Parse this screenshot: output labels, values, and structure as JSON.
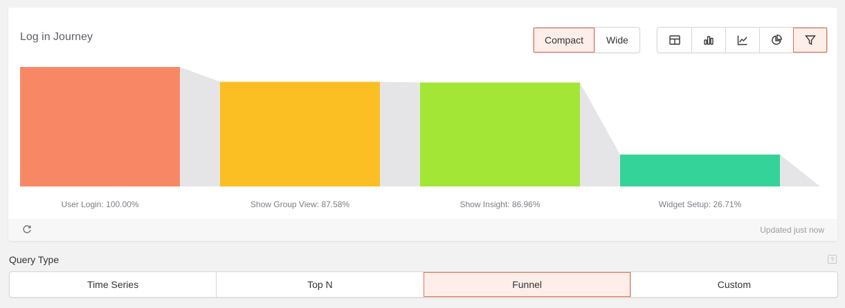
{
  "card": {
    "title": "Log in Journey",
    "layout_options": [
      {
        "label": "Compact",
        "active": true
      },
      {
        "label": "Wide",
        "active": false
      }
    ],
    "viz_icons": [
      {
        "icon": "table-icon",
        "active": false
      },
      {
        "icon": "bar-chart-icon",
        "active": false
      },
      {
        "icon": "line-chart-icon",
        "active": false
      },
      {
        "icon": "pie-chart-icon",
        "active": false
      },
      {
        "icon": "funnel-icon",
        "active": true
      }
    ],
    "footer": {
      "refresh_icon": "refresh-icon",
      "updated": "Updated just now"
    }
  },
  "chart_data": {
    "type": "bar",
    "subtype": "funnel",
    "categories": [
      "User Login",
      "Show Group View",
      "Show Insight",
      "Widget Setup"
    ],
    "values": [
      100.0,
      87.58,
      86.96,
      26.71
    ],
    "labels": [
      "User Login: 100.00%",
      "Show Group View: 87.58%",
      "Show Insight: 86.96%",
      "Widget Setup: 26.71%"
    ],
    "ylim": [
      0,
      100
    ],
    "unit": "%",
    "colors": [
      "#f88865",
      "#fbbf24",
      "#a3e635",
      "#34d399"
    ],
    "connector_color": "#e5e5e7",
    "grid": false
  },
  "query": {
    "label": "Query Type",
    "help": "?",
    "options": [
      {
        "label": "Time Series",
        "active": false
      },
      {
        "label": "Top N",
        "active": false
      },
      {
        "label": "Funnel",
        "active": true
      },
      {
        "label": "Custom",
        "active": false
      }
    ]
  }
}
